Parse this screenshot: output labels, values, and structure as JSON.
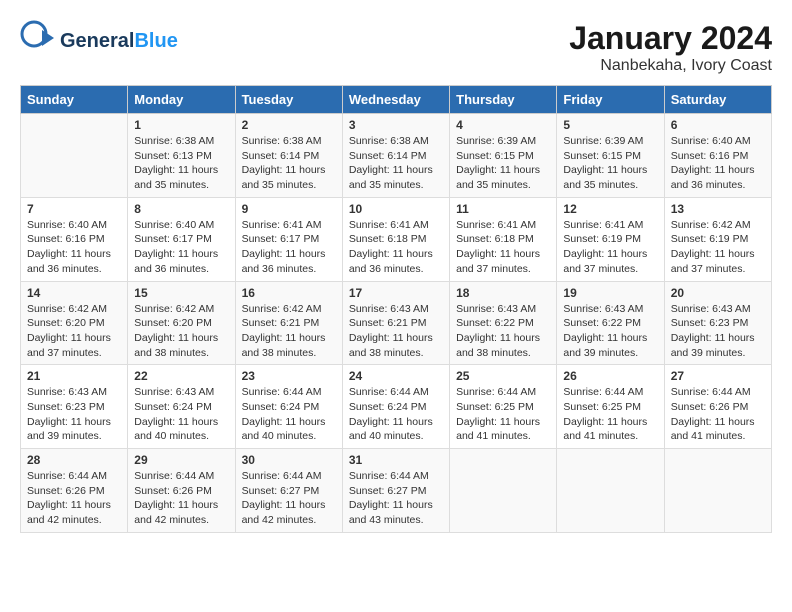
{
  "header": {
    "logo_general": "General",
    "logo_blue": "Blue",
    "title": "January 2024",
    "subtitle": "Nanbekaha, Ivory Coast"
  },
  "calendar": {
    "days_of_week": [
      "Sunday",
      "Monday",
      "Tuesday",
      "Wednesday",
      "Thursday",
      "Friday",
      "Saturday"
    ],
    "weeks": [
      [
        {
          "day": "",
          "info": ""
        },
        {
          "day": "1",
          "info": "Sunrise: 6:38 AM\nSunset: 6:13 PM\nDaylight: 11 hours\nand 35 minutes."
        },
        {
          "day": "2",
          "info": "Sunrise: 6:38 AM\nSunset: 6:14 PM\nDaylight: 11 hours\nand 35 minutes."
        },
        {
          "day": "3",
          "info": "Sunrise: 6:38 AM\nSunset: 6:14 PM\nDaylight: 11 hours\nand 35 minutes."
        },
        {
          "day": "4",
          "info": "Sunrise: 6:39 AM\nSunset: 6:15 PM\nDaylight: 11 hours\nand 35 minutes."
        },
        {
          "day": "5",
          "info": "Sunrise: 6:39 AM\nSunset: 6:15 PM\nDaylight: 11 hours\nand 35 minutes."
        },
        {
          "day": "6",
          "info": "Sunrise: 6:40 AM\nSunset: 6:16 PM\nDaylight: 11 hours\nand 36 minutes."
        }
      ],
      [
        {
          "day": "7",
          "info": "Sunrise: 6:40 AM\nSunset: 6:16 PM\nDaylight: 11 hours\nand 36 minutes."
        },
        {
          "day": "8",
          "info": "Sunrise: 6:40 AM\nSunset: 6:17 PM\nDaylight: 11 hours\nand 36 minutes."
        },
        {
          "day": "9",
          "info": "Sunrise: 6:41 AM\nSunset: 6:17 PM\nDaylight: 11 hours\nand 36 minutes."
        },
        {
          "day": "10",
          "info": "Sunrise: 6:41 AM\nSunset: 6:18 PM\nDaylight: 11 hours\nand 36 minutes."
        },
        {
          "day": "11",
          "info": "Sunrise: 6:41 AM\nSunset: 6:18 PM\nDaylight: 11 hours\nand 37 minutes."
        },
        {
          "day": "12",
          "info": "Sunrise: 6:41 AM\nSunset: 6:19 PM\nDaylight: 11 hours\nand 37 minutes."
        },
        {
          "day": "13",
          "info": "Sunrise: 6:42 AM\nSunset: 6:19 PM\nDaylight: 11 hours\nand 37 minutes."
        }
      ],
      [
        {
          "day": "14",
          "info": "Sunrise: 6:42 AM\nSunset: 6:20 PM\nDaylight: 11 hours\nand 37 minutes."
        },
        {
          "day": "15",
          "info": "Sunrise: 6:42 AM\nSunset: 6:20 PM\nDaylight: 11 hours\nand 38 minutes."
        },
        {
          "day": "16",
          "info": "Sunrise: 6:42 AM\nSunset: 6:21 PM\nDaylight: 11 hours\nand 38 minutes."
        },
        {
          "day": "17",
          "info": "Sunrise: 6:43 AM\nSunset: 6:21 PM\nDaylight: 11 hours\nand 38 minutes."
        },
        {
          "day": "18",
          "info": "Sunrise: 6:43 AM\nSunset: 6:22 PM\nDaylight: 11 hours\nand 38 minutes."
        },
        {
          "day": "19",
          "info": "Sunrise: 6:43 AM\nSunset: 6:22 PM\nDaylight: 11 hours\nand 39 minutes."
        },
        {
          "day": "20",
          "info": "Sunrise: 6:43 AM\nSunset: 6:23 PM\nDaylight: 11 hours\nand 39 minutes."
        }
      ],
      [
        {
          "day": "21",
          "info": "Sunrise: 6:43 AM\nSunset: 6:23 PM\nDaylight: 11 hours\nand 39 minutes."
        },
        {
          "day": "22",
          "info": "Sunrise: 6:43 AM\nSunset: 6:24 PM\nDaylight: 11 hours\nand 40 minutes."
        },
        {
          "day": "23",
          "info": "Sunrise: 6:44 AM\nSunset: 6:24 PM\nDaylight: 11 hours\nand 40 minutes."
        },
        {
          "day": "24",
          "info": "Sunrise: 6:44 AM\nSunset: 6:24 PM\nDaylight: 11 hours\nand 40 minutes."
        },
        {
          "day": "25",
          "info": "Sunrise: 6:44 AM\nSunset: 6:25 PM\nDaylight: 11 hours\nand 41 minutes."
        },
        {
          "day": "26",
          "info": "Sunrise: 6:44 AM\nSunset: 6:25 PM\nDaylight: 11 hours\nand 41 minutes."
        },
        {
          "day": "27",
          "info": "Sunrise: 6:44 AM\nSunset: 6:26 PM\nDaylight: 11 hours\nand 41 minutes."
        }
      ],
      [
        {
          "day": "28",
          "info": "Sunrise: 6:44 AM\nSunset: 6:26 PM\nDaylight: 11 hours\nand 42 minutes."
        },
        {
          "day": "29",
          "info": "Sunrise: 6:44 AM\nSunset: 6:26 PM\nDaylight: 11 hours\nand 42 minutes."
        },
        {
          "day": "30",
          "info": "Sunrise: 6:44 AM\nSunset: 6:27 PM\nDaylight: 11 hours\nand 42 minutes."
        },
        {
          "day": "31",
          "info": "Sunrise: 6:44 AM\nSunset: 6:27 PM\nDaylight: 11 hours\nand 43 minutes."
        },
        {
          "day": "",
          "info": ""
        },
        {
          "day": "",
          "info": ""
        },
        {
          "day": "",
          "info": ""
        }
      ]
    ]
  }
}
